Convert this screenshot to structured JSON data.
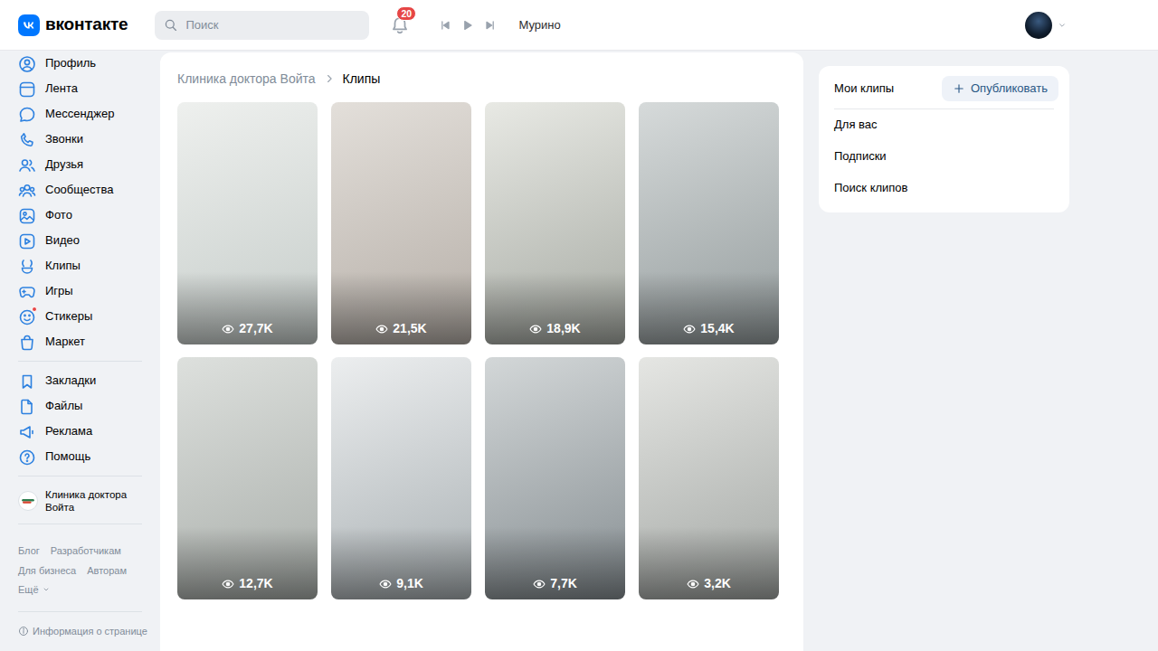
{
  "header": {
    "logo": "вконтакте",
    "search": {
      "placeholder": "Поиск"
    },
    "notifications": {
      "count": "20"
    },
    "player": {
      "track": "Мурино"
    }
  },
  "sidebar": {
    "items": [
      {
        "label": "Профиль",
        "selected": false,
        "dot": false
      },
      {
        "label": "Лента",
        "selected": false,
        "dot": false
      },
      {
        "label": "Мессенджер",
        "selected": false,
        "dot": false
      },
      {
        "label": "Звонки",
        "selected": false,
        "dot": false
      },
      {
        "label": "Друзья",
        "selected": false,
        "dot": false
      },
      {
        "label": "Сообщества",
        "selected": false,
        "dot": false
      },
      {
        "label": "Фото",
        "selected": false,
        "dot": false
      },
      {
        "label": "Видео",
        "selected": false,
        "dot": false
      },
      {
        "label": "Клипы",
        "selected": false,
        "dot": false
      },
      {
        "label": "Игры",
        "selected": false,
        "dot": false
      },
      {
        "label": "Стикеры",
        "selected": false,
        "dot": true
      },
      {
        "label": "Маркет",
        "selected": false,
        "dot": false
      }
    ],
    "secondary_items": [
      {
        "label": "Закладки",
        "selected": false
      },
      {
        "label": "Файлы",
        "selected": false
      },
      {
        "label": "Реклама",
        "selected": false
      },
      {
        "label": "Помощь",
        "selected": false
      }
    ],
    "community": {
      "name": "Клиника доктора Войта"
    },
    "footer_links": [
      "Блог",
      "Разработчикам",
      "Для бизнеса",
      "Авторам",
      "Ещё"
    ],
    "info": "Информация о странице"
  },
  "breadcrumb": [
    "Клиника доктора Войта",
    "Клипы"
  ],
  "clips": [
    {
      "views": "27,7K"
    },
    {
      "views": "21,5K"
    },
    {
      "views": "18,9K"
    },
    {
      "views": "15,4K"
    },
    {
      "views": "12,7K"
    },
    {
      "views": "9,1K"
    },
    {
      "views": "7,7K"
    },
    {
      "views": "3,2K"
    }
  ],
  "right_panel": {
    "title": "Мои клипы",
    "publish_button": "Опубликовать",
    "menu": [
      {
        "label": "Для вас",
        "selected": false
      },
      {
        "label": "Подписки",
        "selected": false
      },
      {
        "label": "Поиск клипов",
        "selected": false
      }
    ]
  }
}
